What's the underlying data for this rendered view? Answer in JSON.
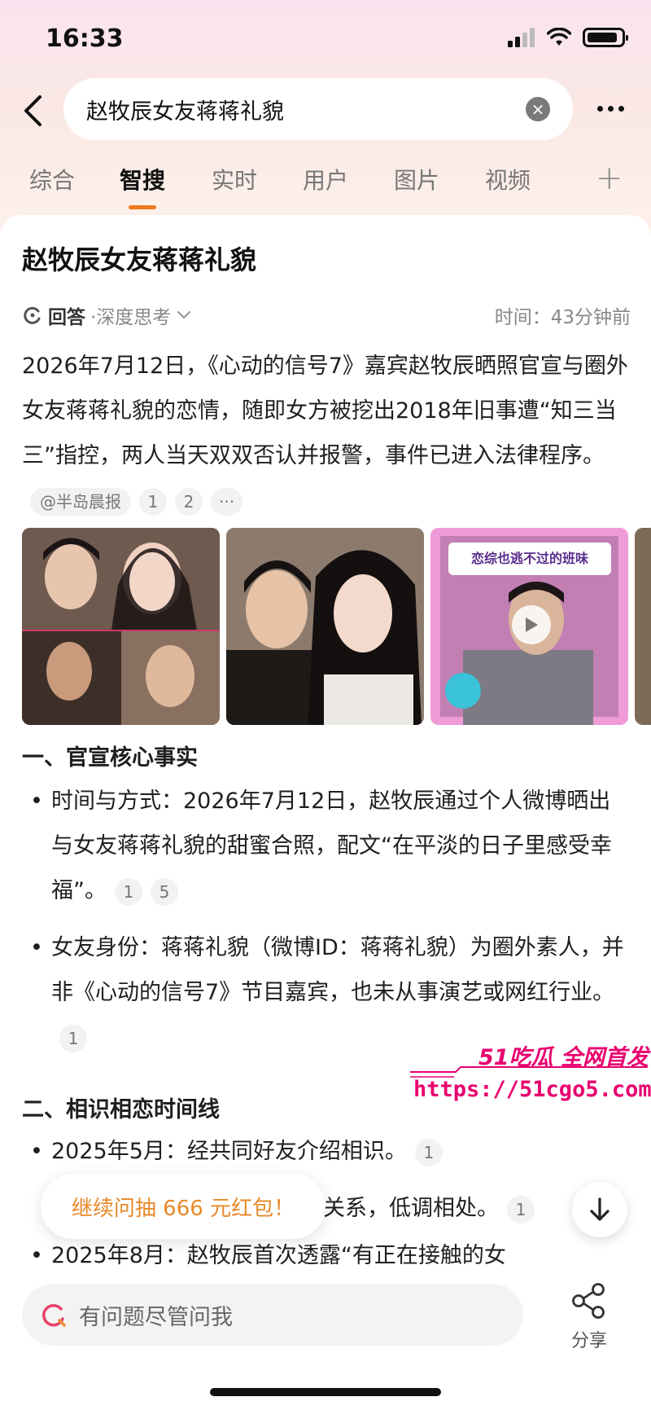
{
  "status": {
    "time": "16:33"
  },
  "header": {
    "search_query": "赵牧辰女友蒋蒋礼貌",
    "tabs": [
      "综合",
      "智搜",
      "实时",
      "用户",
      "图片",
      "视频"
    ],
    "active_tab": "智搜"
  },
  "answer": {
    "title": "赵牧辰女友蒋蒋礼貌",
    "meta_label": "回答",
    "meta_mode": "·深度思考",
    "meta_time": "时间：43分钟前",
    "summary": "2026年7月12日，《心动的信号7》嘉宾赵牧辰晒照官宣与圈外女友蒋蒋礼貌的恋情，随即女方被挖出2018年旧事遭“知三当三”指控，两人当天双双否认并报警，事件已进入法律程序。",
    "summary_source": "@半岛晨报",
    "summary_cites": [
      "1",
      "2",
      "···"
    ],
    "video_banner": "恋综也逃不过的班味",
    "section1_title": "一、官宣核心事实",
    "section1_items": [
      {
        "text": "时间与方式：2026年7月12日，赵牧辰通过个人微博晒出与女友蒋蒋礼貌的甜蜜合照，配文“在平淡的日子里感受幸福”。",
        "cites": [
          "1",
          "5"
        ]
      },
      {
        "text": "女友身份：蒋蒋礼貌（微博ID：蒋蒋礼貌）为圈外素人，并非《心动的信号7》节目嘉宾，也未从事演艺或网红行业。",
        "cites": [
          "1"
        ]
      }
    ],
    "section2_title": "二、相识相恋时间线",
    "section2_items": [
      {
        "text": "2025年5月：经共同好友介绍相识。",
        "cites": [
          "1"
        ]
      },
      {
        "text": "爱关系，低调相处。",
        "cites": [
          "1"
        ]
      },
      {
        "text": "2025年8月：赵牧辰首次透露“有正在接触的女"
      }
    ]
  },
  "watermark": {
    "brand": "51吃瓜 全网首发",
    "url": "https://51cgo5.com"
  },
  "floating": {
    "tip": "继续问抽 666 元红包！"
  },
  "bottom": {
    "ask_placeholder": "有问题尽管问我",
    "share_label": "分享"
  }
}
